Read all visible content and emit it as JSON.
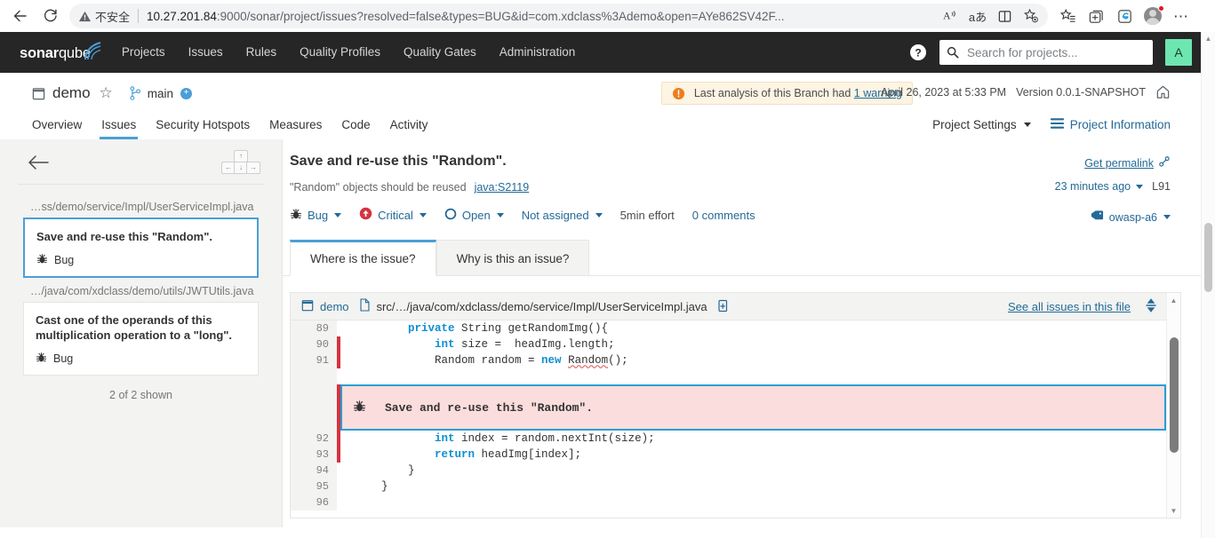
{
  "browser": {
    "back_label": "Back",
    "reload_label": "Reload",
    "security_label": "不安全",
    "url_host": "10.27.201.84",
    "url_rest": ":9000/sonar/project/issues?resolved=false&types=BUG&id=com.xdclass%3Ademo&open=AYe862SV42F...",
    "read_aloud_label": "A",
    "translate_label": "aあ",
    "split_screen_label": "Split screen",
    "favorite_label": "Add to favorites",
    "collections_label": "Collections",
    "browser_essentials_label": "Browser essentials",
    "copilot_label": "Copilot",
    "profile_label": "Profile",
    "settings_label": "Settings and more"
  },
  "topnav": {
    "logo_bold": "sonar",
    "logo_light": "qube",
    "items": [
      {
        "label": "Projects"
      },
      {
        "label": "Issues"
      },
      {
        "label": "Rules"
      },
      {
        "label": "Quality Profiles"
      },
      {
        "label": "Quality Gates"
      },
      {
        "label": "Administration"
      }
    ],
    "help_label": "?",
    "search_placeholder": "Search for projects...",
    "search_value": "",
    "user_initial": "A"
  },
  "project": {
    "name": "demo",
    "branch": "main",
    "branch_badge": "+",
    "warning_text_pre": "Last analysis of this Branch had ",
    "warning_link": "1 warning",
    "analysis_date": "April 26, 2023 at 5:33 PM",
    "version": "Version 0.0.1-SNAPSHOT",
    "tabs": [
      {
        "label": "Overview",
        "active": false
      },
      {
        "label": "Issues",
        "active": true
      },
      {
        "label": "Security Hotspots",
        "active": false
      },
      {
        "label": "Measures",
        "active": false
      },
      {
        "label": "Code",
        "active": false
      },
      {
        "label": "Activity",
        "active": false
      }
    ],
    "project_settings_label": "Project Settings",
    "project_information_label": "Project Information"
  },
  "sidebar": {
    "back_label": "Back to list",
    "groups": [
      {
        "file": "…ss/demo/service/Impl/UserServiceImpl.java",
        "issues": [
          {
            "message": "Save and re-use this \"Random\".",
            "type": "Bug",
            "selected": true
          }
        ]
      },
      {
        "file": "…/java/com/xdclass/demo/utils/JWTUtils.java",
        "issues": [
          {
            "message": "Cast one of the operands of this multiplication operation to a \"long\".",
            "type": "Bug",
            "selected": false
          }
        ]
      }
    ],
    "count_label": "2 of 2 shown"
  },
  "issue": {
    "title": "Save and re-use this \"Random\".",
    "rule_text": "\"Random\" objects should be reused",
    "rule_key": "java:S2119",
    "type": "Bug",
    "severity": "Critical",
    "status": "Open",
    "assignee": "Not assigned",
    "effort": "5min effort",
    "comments": "0 comments",
    "permalink_label": "Get permalink",
    "age": "23 minutes ago",
    "line_label": "L91",
    "tag": "owasp-a6",
    "tabs": [
      {
        "label": "Where is the issue?",
        "active": true
      },
      {
        "label": "Why is this an issue?",
        "active": false
      }
    ]
  },
  "code": {
    "project_label": "demo",
    "file_path": "src/…/java/com/xdclass/demo/service/Impl/UserServiceImpl.java",
    "see_all_label": "See all issues in this file",
    "banner_message": "Save and re-use this \"Random\".",
    "lines": [
      {
        "number": "89",
        "marker": false,
        "segments": [
          {
            "text": "        ",
            "style": "plain"
          },
          {
            "text": "private",
            "style": "kw"
          },
          {
            "text": " String getRandomImg(){",
            "style": "plain"
          }
        ]
      },
      {
        "number": "90",
        "marker": true,
        "segments": [
          {
            "text": "            ",
            "style": "plain"
          },
          {
            "text": "int",
            "style": "kw"
          },
          {
            "text": " size =  headImg.length;",
            "style": "plain"
          }
        ]
      },
      {
        "number": "91",
        "marker": true,
        "segments": [
          {
            "text": "            Random random = ",
            "style": "plain"
          },
          {
            "text": "new",
            "style": "kw"
          },
          {
            "text": " ",
            "style": "plain"
          },
          {
            "text": "Random",
            "style": "squiggle"
          },
          {
            "text": "();",
            "style": "plain"
          }
        ]
      },
      {
        "number": "92",
        "marker": true,
        "segments": [
          {
            "text": "            ",
            "style": "plain"
          },
          {
            "text": "int",
            "style": "kw"
          },
          {
            "text": " index = random.nextInt(size);",
            "style": "plain"
          }
        ]
      },
      {
        "number": "93",
        "marker": true,
        "segments": [
          {
            "text": "            ",
            "style": "plain"
          },
          {
            "text": "return",
            "style": "kw"
          },
          {
            "text": " headImg[index];",
            "style": "plain"
          }
        ]
      },
      {
        "number": "94",
        "marker": false,
        "segments": [
          {
            "text": "        }",
            "style": "plain"
          }
        ]
      },
      {
        "number": "95",
        "marker": false,
        "segments": [
          {
            "text": "    }",
            "style": "plain"
          }
        ]
      },
      {
        "number": "96",
        "marker": false,
        "segments": [
          {
            "text": "",
            "style": "plain"
          }
        ]
      }
    ]
  },
  "colors": {
    "nav_bg": "#262626",
    "accent_blue": "#4b9fd5",
    "link_blue": "#236a97",
    "bug_red": "#d4333f",
    "highlight_pink": "#fbdddd",
    "user_green": "#6ee6b0",
    "page_bg": "#f3f3f1"
  }
}
